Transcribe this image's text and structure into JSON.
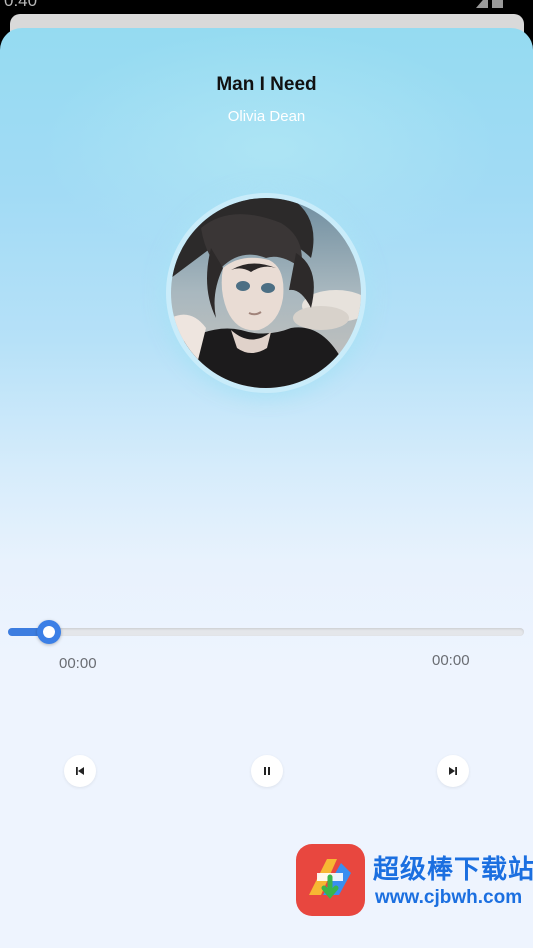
{
  "status_bar": {
    "time": "0:40"
  },
  "player": {
    "title": "Man I Need",
    "artist": "Olivia Dean",
    "progress_fraction": 0.08,
    "current_time": "00:00",
    "total_time": "00:00"
  },
  "controls": {
    "prev_icon": "skip-previous-icon",
    "play_pause_icon": "pause-icon",
    "next_icon": "skip-next-icon"
  },
  "watermark": {
    "title": "超级棒下载站",
    "url": "www.cjbwh.com"
  },
  "colors": {
    "accent": "#3b7fe6",
    "background_top": "#95dbf1",
    "background_bottom": "#eef4fe"
  }
}
